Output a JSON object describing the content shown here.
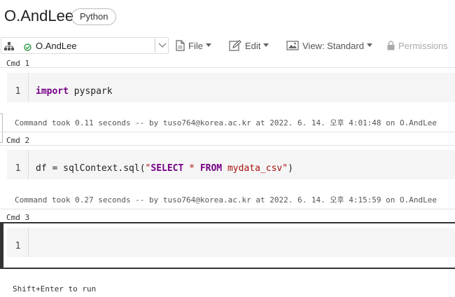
{
  "notebook": {
    "title": "O.AndLee",
    "language": "Python"
  },
  "toolbar": {
    "cluster_name": "O.AndLee",
    "cluster_status_color": "#2e9b4a",
    "file_label": "File",
    "edit_label": "Edit",
    "view_label": "View: Standard",
    "permissions_label": "Permissions"
  },
  "cells": [
    {
      "label": "Cmd 1",
      "line_no": "1",
      "code": {
        "kw1": "import",
        "rest": " pyspark"
      },
      "result": "Command took 0.11 seconds -- by tuso764@korea.ac.kr at 2022. 6. 14. 오후 4:01:48 on O.AndLee"
    },
    {
      "label": "Cmd 2",
      "line_no": "1",
      "code": {
        "pre": "df = sqlContext.sql(",
        "q1": "\"",
        "k1": "SELECT",
        "s1": " * ",
        "k2": "FROM",
        "s2": " mydata_csv\"",
        "post": ")"
      },
      "result": "Command took 0.27 seconds -- by tuso764@korea.ac.kr at 2022. 6. 14. 오후 4:15:59 on O.AndLee"
    },
    {
      "label": "Cmd 3",
      "line_no": "1"
    }
  ],
  "hint": "Shift+Enter to run"
}
